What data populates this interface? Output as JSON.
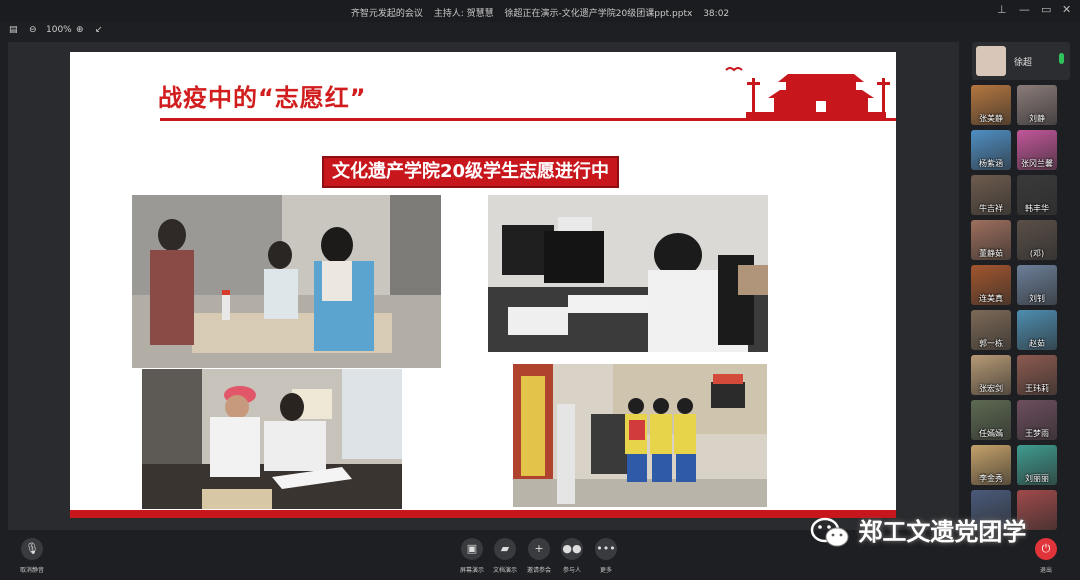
{
  "titlebar": {
    "meeting_name": "齐智元发起的会议",
    "host": "主持人: 贺慧慧",
    "presenting": "徐超正在演示-文化遗产学院20级团课ppt.pptx",
    "timer": "38:02"
  },
  "toolbar": {
    "zoom": "100%"
  },
  "slide": {
    "title": "战疫中的“志愿红”",
    "banner": "文化遗产学院20级学生志愿进行中"
  },
  "sidebar": {
    "self": {
      "name": "徐超"
    },
    "participants": [
      {
        "name": "张美静",
        "color": "#b5773f"
      },
      {
        "name": "刘静",
        "color": "#8a7c7a"
      },
      {
        "name": "杨紫涵",
        "color": "#4f8fc4"
      },
      {
        "name": "张冈兰馨",
        "color": "#c2569a"
      },
      {
        "name": "牛吉祥",
        "color": "#6e5c4e"
      },
      {
        "name": "韩丰华",
        "color": "#3a3a3a"
      },
      {
        "name": "董静茹",
        "color": "#9e6f5d"
      },
      {
        "name": "(邓)",
        "color": "#5a4f47"
      },
      {
        "name": "连美真",
        "color": "#a2562e"
      },
      {
        "name": "刘钊",
        "color": "#6c7f99"
      },
      {
        "name": "郭一栋",
        "color": "#7d6a57"
      },
      {
        "name": "赵茹",
        "color": "#4e8eb0"
      },
      {
        "name": "张宏剑",
        "color": "#b79a75"
      },
      {
        "name": "王玮莉",
        "color": "#8b5a4f"
      },
      {
        "name": "任嫣嫣",
        "color": "#5d6a52"
      },
      {
        "name": "王梦雨",
        "color": "#6d4e5e"
      },
      {
        "name": "李金秀",
        "color": "#c6a26a"
      },
      {
        "name": "刘丽丽",
        "color": "#3f9c8f"
      },
      {
        "name": "",
        "color": "#4a5a7a"
      },
      {
        "name": "",
        "color": "#a04a4a"
      }
    ]
  },
  "controls": {
    "mute": "取消静音",
    "screen_share": "屏幕演示",
    "doc_share": "文档演示",
    "invite": "邀请参会",
    "participants": "参与人",
    "more": "更多",
    "leave": "退出"
  },
  "watermark": {
    "text": "郑工文遗党团学"
  }
}
